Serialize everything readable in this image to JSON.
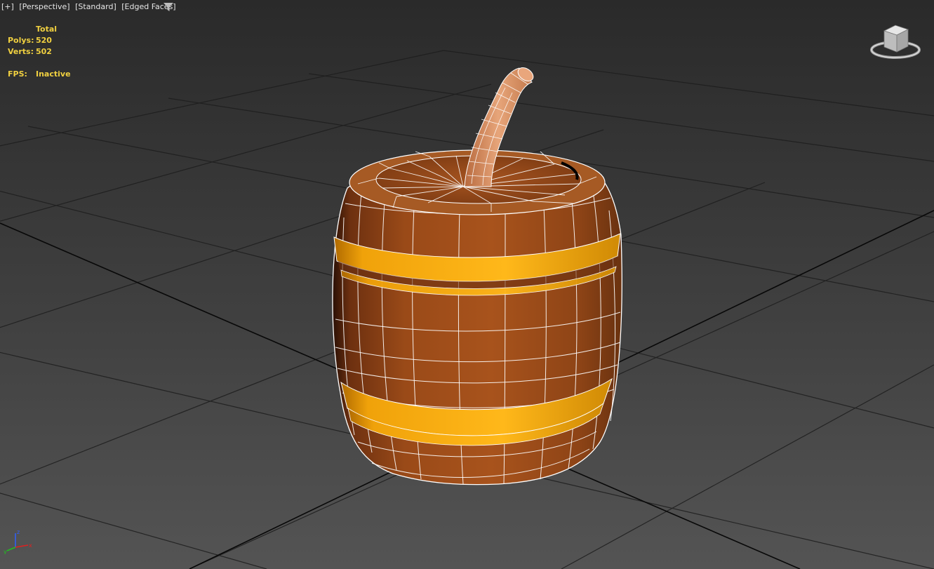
{
  "viewport": {
    "labels": [
      "[+]",
      "[Perspective]",
      "[Standard]",
      "[Edged Faces]"
    ],
    "filter_icon": "funnel-icon"
  },
  "stats": {
    "column_header": "Total",
    "polys_label": "Polys:",
    "polys_value": "520",
    "verts_label": "Verts:",
    "verts_value": "502",
    "fps_label": "FPS:",
    "fps_value": "Inactive"
  },
  "viewcube": {
    "icon": "viewcube-icon"
  },
  "axis_tripod": {
    "x": "x",
    "y": "y",
    "z": "z"
  },
  "colors": {
    "stats_text": "#f0d040",
    "wood": "#9a4a17",
    "wood_light": "#c2692a",
    "band": "#f5a90a",
    "grid": "#1c1c1c",
    "axis_x": "#e02020",
    "axis_y": "#20c020",
    "axis_z": "#3060ff"
  }
}
